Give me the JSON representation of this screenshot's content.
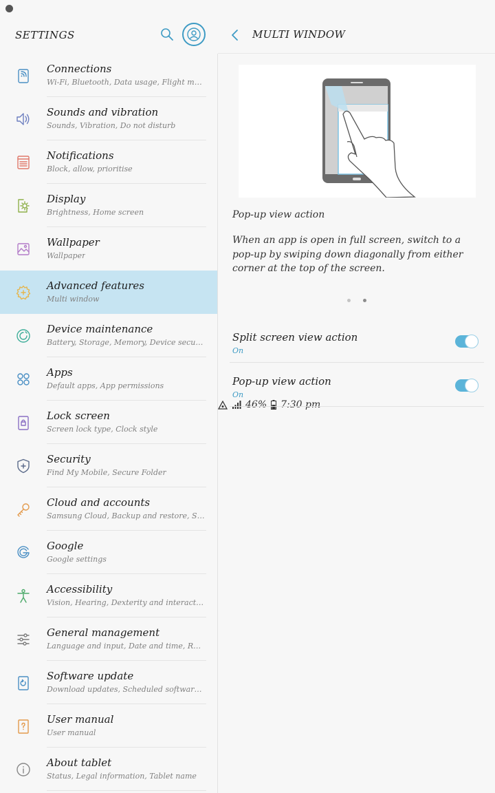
{
  "status_bar": {
    "battery": "46%",
    "time": "7:30 pm"
  },
  "left_header": {
    "title": "SETTINGS"
  },
  "menu": [
    {
      "label": "Connections",
      "sub": "Wi-Fi, Bluetooth, Data usage, Flight mode",
      "icon": "connections-icon",
      "color": "#4a8fc4"
    },
    {
      "label": "Sounds and vibration",
      "sub": "Sounds, Vibration, Do not disturb",
      "icon": "speaker-icon",
      "color": "#6d7fc0"
    },
    {
      "label": "Notifications",
      "sub": "Block, allow, prioritise",
      "icon": "notifications-icon",
      "color": "#e0786a"
    },
    {
      "label": "Display",
      "sub": "Brightness, Home screen",
      "icon": "display-icon",
      "color": "#8fb04a"
    },
    {
      "label": "Wallpaper",
      "sub": "Wallpaper",
      "icon": "wallpaper-icon",
      "color": "#b37cc8"
    },
    {
      "label": "Advanced features",
      "sub": "Multi window",
      "icon": "gear-plus-icon",
      "color": "#e6b54c",
      "selected": true
    },
    {
      "label": "Device maintenance",
      "sub": "Battery, Storage, Memory, Device security",
      "icon": "maintenance-icon",
      "color": "#3fae9a"
    },
    {
      "label": "Apps",
      "sub": "Default apps, App permissions",
      "icon": "apps-icon",
      "color": "#4a8fc4"
    },
    {
      "label": "Lock screen",
      "sub": "Screen lock type, Clock style",
      "icon": "lock-icon",
      "color": "#8a6fc4"
    },
    {
      "label": "Security",
      "sub": "Find My Mobile, Secure Folder",
      "icon": "shield-icon",
      "color": "#5a6a8a"
    },
    {
      "label": "Cloud and accounts",
      "sub": "Samsung Cloud, Backup and restore, Smart Switch",
      "icon": "key-icon",
      "color": "#e39a4c"
    },
    {
      "label": "Google",
      "sub": "Google settings",
      "icon": "google-icon",
      "color": "#4a8fc4"
    },
    {
      "label": "Accessibility",
      "sub": "Vision, Hearing, Dexterity and interaction",
      "icon": "accessibility-icon",
      "color": "#4caa6a"
    },
    {
      "label": "General management",
      "sub": "Language and input, Date and time, Reset",
      "icon": "sliders-icon",
      "color": "#7a7a7a"
    },
    {
      "label": "Software update",
      "sub": "Download updates, Scheduled software updates",
      "icon": "software-update-icon",
      "color": "#4a8fc4"
    },
    {
      "label": "User manual",
      "sub": "User manual",
      "icon": "user-manual-icon",
      "color": "#e39a4c"
    },
    {
      "label": "About tablet",
      "sub": "Status, Legal information, Tablet name",
      "icon": "info-icon",
      "color": "#888888"
    }
  ],
  "right_header": {
    "title": "MULTI WINDOW"
  },
  "illustration": {
    "title": "Pop-up view action",
    "description": "When an app is open in full screen, switch to a pop-up by swiping down diagonally from either corner at the top of the screen."
  },
  "toggles": [
    {
      "label": "Split screen view action",
      "status": "On"
    },
    {
      "label": "Pop-up view action",
      "status": "On"
    }
  ],
  "colors": {
    "accent": "#3e9bc4",
    "selected_bg": "#c6e4f2",
    "switch_on": "#5bb4d9"
  }
}
